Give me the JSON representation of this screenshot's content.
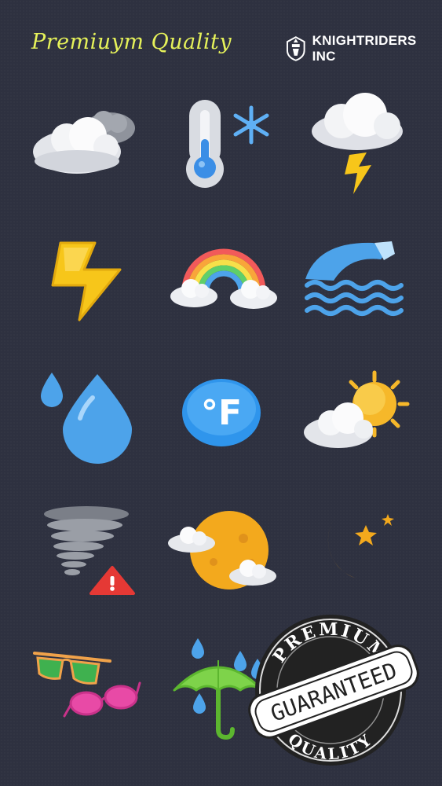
{
  "header": {
    "title": "Premiuym Quality",
    "brand_name": "KNIGHTRIDERS INC",
    "brand_logo_icon": "knight-helmet-icon"
  },
  "icons": [
    "cloudy-icon",
    "thermometer-snowflake-icon",
    "thunderstorm-icon",
    "lightning-bolt-icon",
    "rainbow-icon",
    "wave-icon",
    "raindrops-icon",
    "fahrenheit-icon",
    "partly-sunny-icon",
    "tornado-warning-icon",
    "moon-clouds-icon",
    "crescent-moon-stars-icon",
    "sunglasses-icon",
    "umbrella-rain-icon"
  ],
  "badge": {
    "top_text": "PREMIUM",
    "ribbon_text": "GUARANTEED",
    "bottom_text": "QUALITY"
  },
  "fahrenheit_label": "°F",
  "colors": {
    "background": "#2e3140",
    "title": "#e6f25a",
    "bolt": "#f7c61a",
    "water": "#4da3ea",
    "sun": "#f6b82a",
    "moon": "#f3a91d",
    "badge_dark": "#222222"
  }
}
